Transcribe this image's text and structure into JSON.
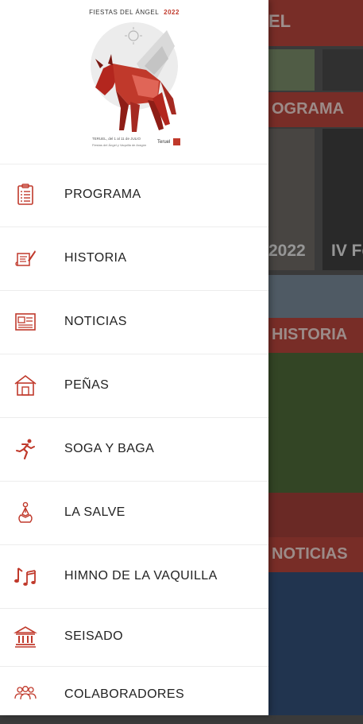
{
  "background": {
    "title": "EL",
    "sections": {
      "programa": "OGRAMA",
      "historia": "HISTORIA",
      "noticias": "NOTICIAS"
    },
    "tile_text_1": "2022",
    "tile_text_2": "IV Fe",
    "accent_color": "#b8463c"
  },
  "drawer": {
    "poster": {
      "title": "FIESTAS DEL ÁNGEL",
      "year": "2022",
      "caption": "TERUEL, del 1 al 11 de JULIO",
      "caption2": "Fiestas del Ángel y Vaquilla de Aragón",
      "brand": "Teruel"
    },
    "menu": [
      {
        "label": "PROGRAMA",
        "icon": "clipboard-list-icon"
      },
      {
        "label": "HISTORIA",
        "icon": "scroll-quill-icon"
      },
      {
        "label": "NOTICIAS",
        "icon": "newspaper-icon"
      },
      {
        "label": "PEÑAS",
        "icon": "house-icon"
      },
      {
        "label": "SOGA Y BAGA",
        "icon": "running-person-icon"
      },
      {
        "label": "LA SALVE",
        "icon": "praying-person-icon"
      },
      {
        "label": "HIMNO DE LA VAQUILLA",
        "icon": "music-notes-icon"
      },
      {
        "label": "SEISADO",
        "icon": "institution-icon"
      },
      {
        "label": "COLABORADORES",
        "icon": "group-people-icon"
      }
    ],
    "icon_color": "#c0392b"
  }
}
